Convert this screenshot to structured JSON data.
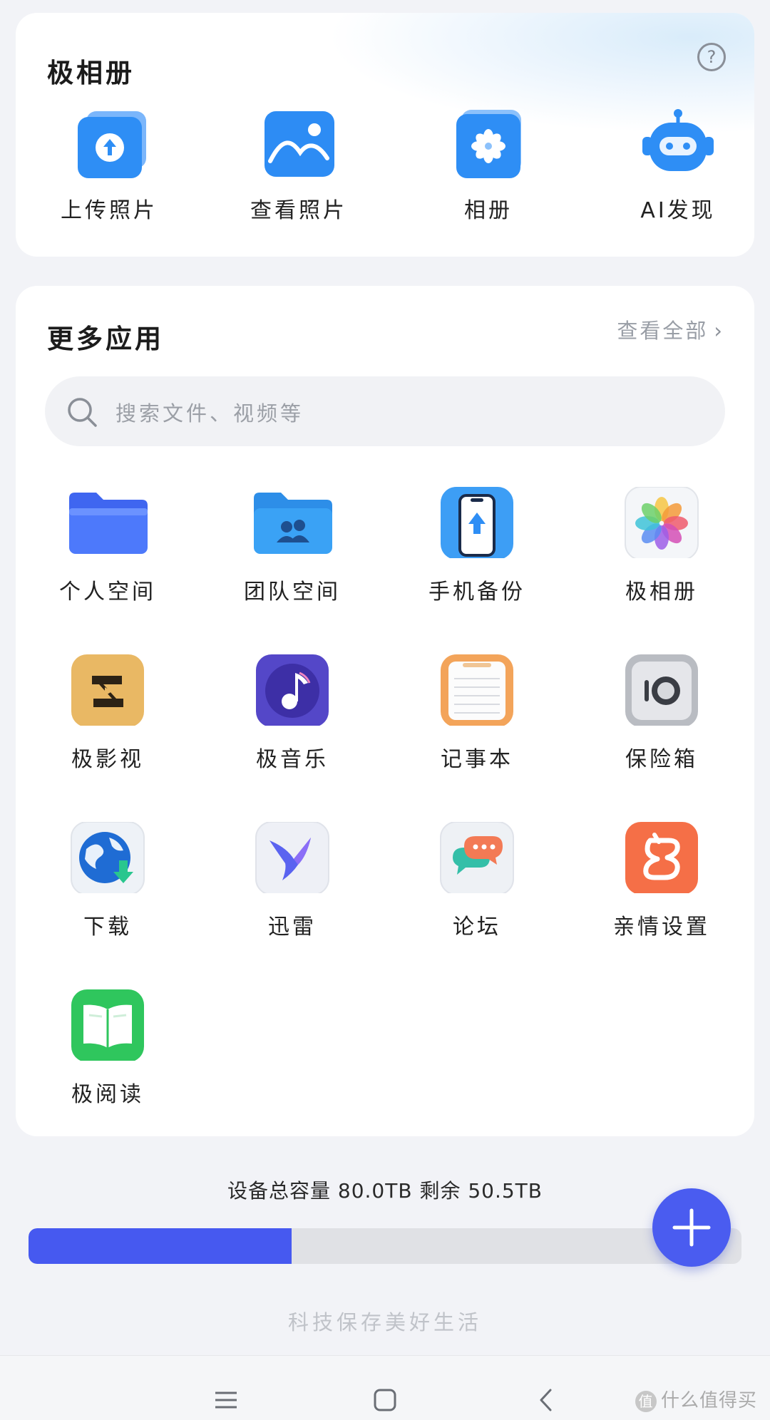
{
  "album_card": {
    "title": "极相册",
    "help_icon": "?",
    "items": [
      {
        "label": "上传照片",
        "icon": "upload-photo-icon"
      },
      {
        "label": "查看照片",
        "icon": "view-photo-icon"
      },
      {
        "label": "相册",
        "icon": "album-icon"
      },
      {
        "label": "AI发现",
        "icon": "ai-robot-icon"
      }
    ]
  },
  "apps_card": {
    "title": "更多应用",
    "view_all": "查看全部",
    "view_all_chevron": "›",
    "search_placeholder": "搜索文件、视频等",
    "apps": [
      {
        "label": "个人空间",
        "icon": "personal-folder-icon"
      },
      {
        "label": "团队空间",
        "icon": "team-folder-icon"
      },
      {
        "label": "手机备份",
        "icon": "phone-backup-icon"
      },
      {
        "label": "极相册",
        "icon": "photos-flower-icon"
      },
      {
        "label": "极影视",
        "icon": "video-icon"
      },
      {
        "label": "极音乐",
        "icon": "music-icon"
      },
      {
        "label": "记事本",
        "icon": "notepad-icon"
      },
      {
        "label": "保险箱",
        "icon": "safe-icon"
      },
      {
        "label": "下载",
        "icon": "download-globe-icon"
      },
      {
        "label": "迅雷",
        "icon": "thunder-bird-icon"
      },
      {
        "label": "论坛",
        "icon": "forum-chat-icon"
      },
      {
        "label": "亲情设置",
        "icon": "family-settings-icon"
      },
      {
        "label": "极阅读",
        "icon": "reader-book-icon"
      }
    ]
  },
  "storage": {
    "text": "设备总容量 80.0TB  剩余 50.5TB",
    "total_tb": 80.0,
    "remaining_tb": 50.5,
    "used_fraction": 0.369,
    "bar_color": "#4659f0"
  },
  "fab": {
    "icon": "plus-icon",
    "color": "#4a5cf0"
  },
  "slogan": "科技保存美好生活",
  "navbar": {
    "icons": [
      "menu-icon",
      "home-square-icon",
      "back-chevron-icon"
    ]
  },
  "watermark": {
    "badge": "值",
    "text": "什么值得买"
  }
}
